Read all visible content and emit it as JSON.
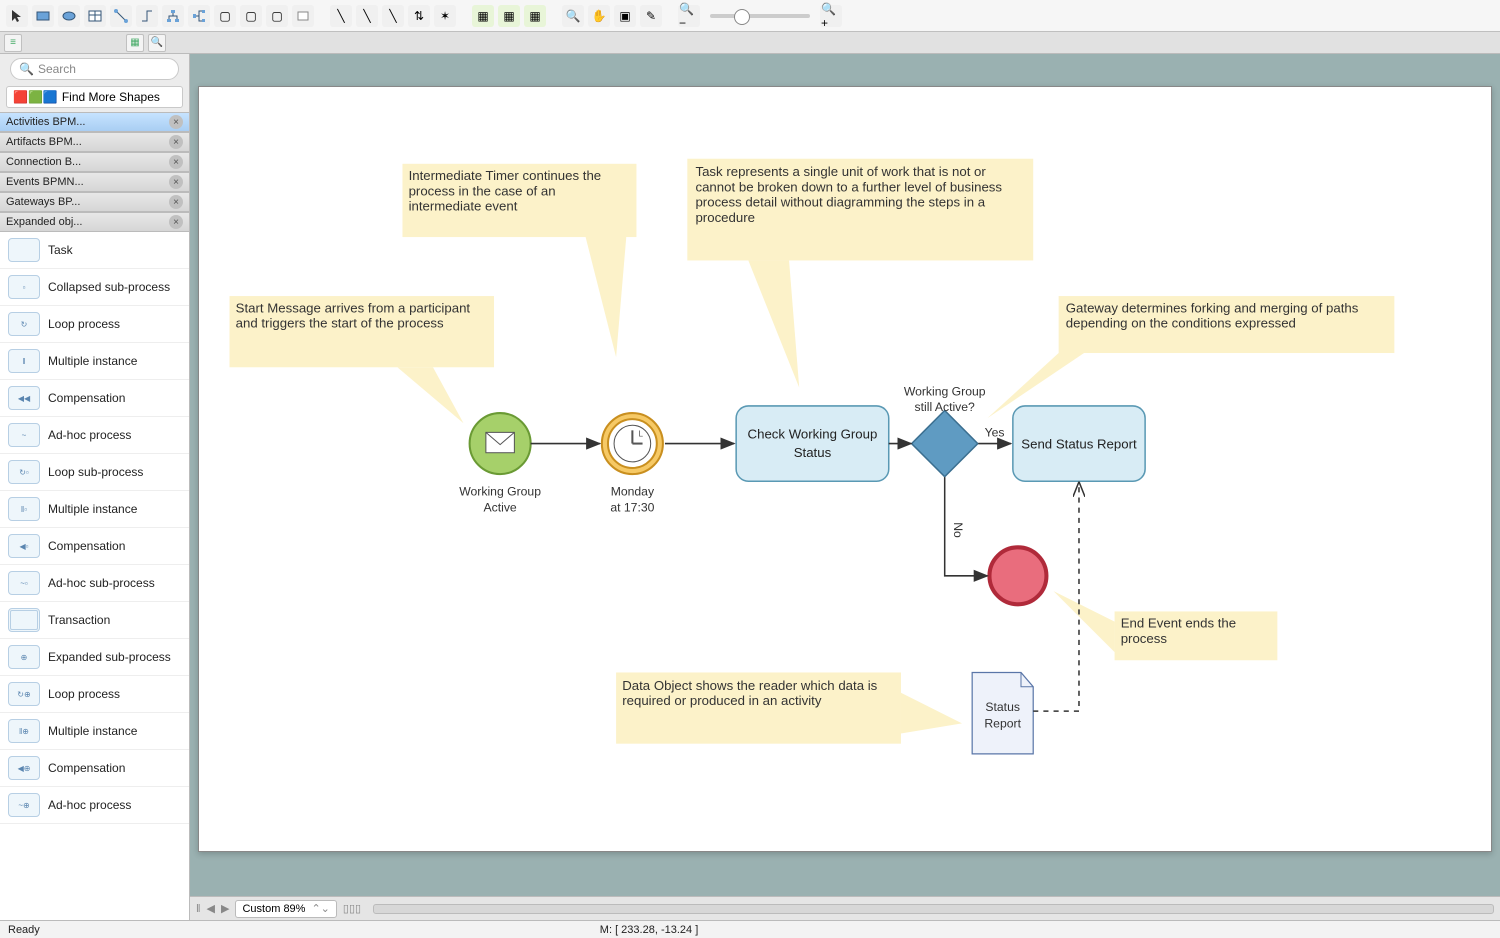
{
  "toolbar_icons": [
    "arrow",
    "rect",
    "oval",
    "table",
    "conn1",
    "conn2",
    "tree1",
    "tree2",
    "tree3",
    "tree4",
    "tree5",
    "obj",
    "line1",
    "line2",
    "line3",
    "line4",
    "line5",
    "g1",
    "g2",
    "g3",
    "hand1",
    "hand2",
    "stamp",
    "dropper",
    "zoom-out",
    "slider",
    "zoom-in"
  ],
  "sidebar": {
    "search_placeholder": "Search",
    "find_more": "Find More Shapes",
    "panels": [
      {
        "label": "Activities BPM...",
        "active": true
      },
      {
        "label": "Artifacts BPM..."
      },
      {
        "label": "Connection B..."
      },
      {
        "label": "Events BPMN..."
      },
      {
        "label": "Gateways BP..."
      },
      {
        "label": "Expanded obj..."
      }
    ],
    "shapes": [
      "Task",
      "Collapsed sub-process",
      "Loop process",
      "Multiple instance",
      "Compensation",
      "Ad-hoc process",
      "Loop sub-process",
      "Multiple instance",
      "Compensation",
      "Ad-hoc sub-process",
      "Transaction",
      "Expanded sub-process",
      "Loop process",
      "Multiple instance",
      "Compensation",
      "Ad-hoc process"
    ]
  },
  "diagram": {
    "notes": {
      "start": "Start Message arrives from a participant and triggers the start of the process",
      "timer": "Intermediate Timer continues the process in the case of an intermediate event",
      "task": "Task represents a single unit of work that is not or cannot be broken down to a further level of business process detail without diagramming the steps in a procedure",
      "gateway": "Gateway determines forking and merging of paths depending on the conditions expressed",
      "end": "End Event ends the process",
      "dataobj": "Data Object shows the reader which data is required or produced in an activity"
    },
    "start_event_label_l1": "Working Group",
    "start_event_label_l2": "Active",
    "timer_label_l1": "Monday",
    "timer_label_l2": "at 17:30",
    "task_check_l1": "Check Working Group",
    "task_check_l2": "Status",
    "gateway_label_l1": "Working Group",
    "gateway_label_l2": "still Active?",
    "edge_yes": "Yes",
    "edge_no": "No",
    "task_send": "Send Status Report",
    "data_object_l1": "Status",
    "data_object_l2": "Report"
  },
  "bottom": {
    "zoom_label": "Custom 89%"
  },
  "status": {
    "ready": "Ready",
    "mouse": "M: [ 233.28, -13.24 ]"
  }
}
